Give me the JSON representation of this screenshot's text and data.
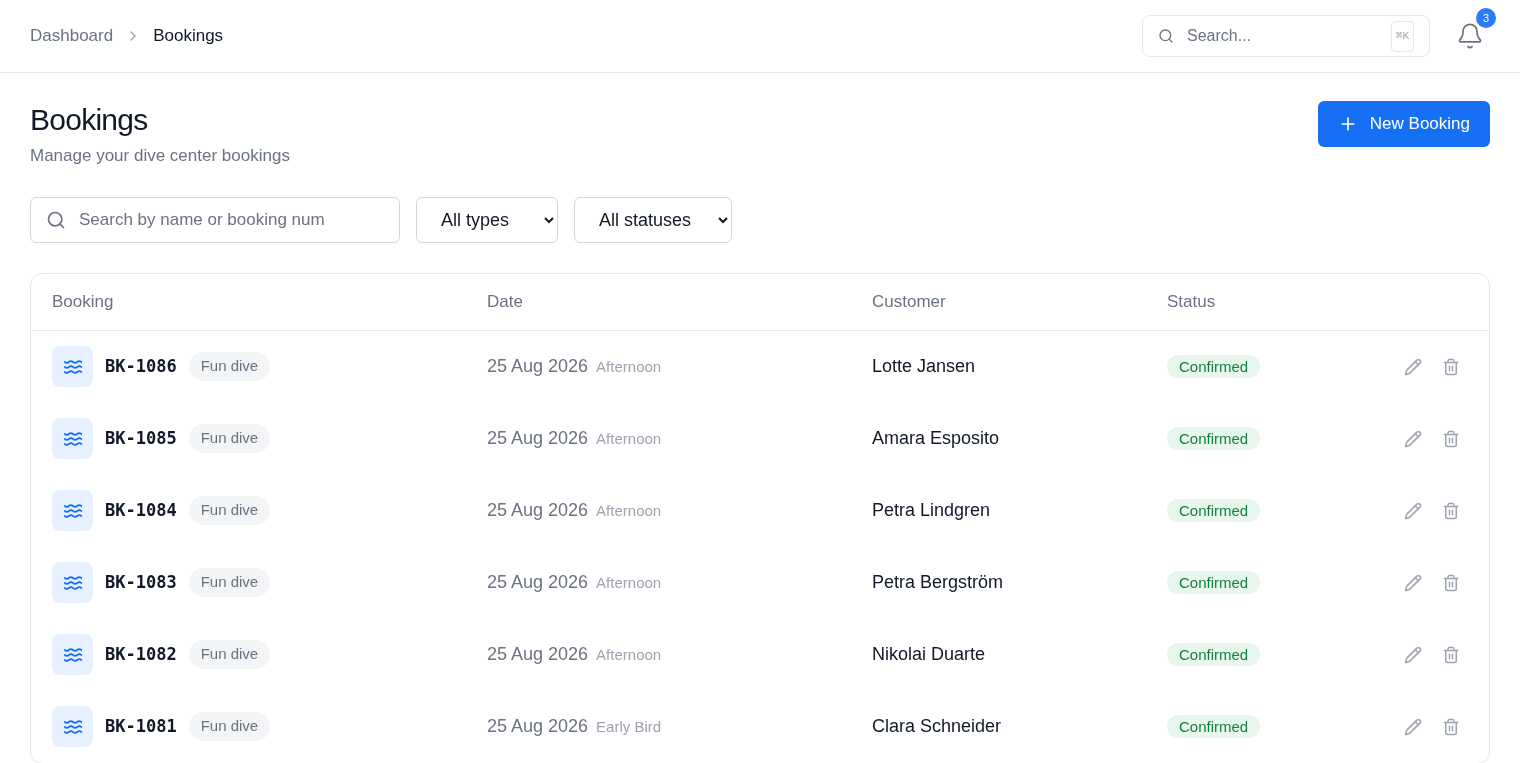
{
  "breadcrumb": [
    {
      "label": "Dashboard",
      "selected": false
    },
    {
      "label": "Bookings",
      "selected": true
    }
  ],
  "top_search": {
    "placeholder": "Search...",
    "shortcut": "⌘K"
  },
  "notifications": {
    "count": "3"
  },
  "page": {
    "title": "Bookings",
    "subtitle": "Manage your dive center bookings",
    "new_button": "New Booking"
  },
  "filters": {
    "search_placeholder": "Search by name or booking num",
    "type_select": "All types",
    "status_select": "All statuses"
  },
  "table": {
    "columns": [
      "Booking",
      "Date",
      "Customer",
      "Status"
    ],
    "rows": [
      {
        "number": "BK-1086",
        "type": "Fun dive",
        "date": "25 Aug 2026",
        "slot": "Afternoon",
        "customer": "Lotte Jansen",
        "status": "Confirmed"
      },
      {
        "number": "BK-1085",
        "type": "Fun dive",
        "date": "25 Aug 2026",
        "slot": "Afternoon",
        "customer": "Amara Esposito",
        "status": "Confirmed"
      },
      {
        "number": "BK-1084",
        "type": "Fun dive",
        "date": "25 Aug 2026",
        "slot": "Afternoon",
        "customer": "Petra Lindgren",
        "status": "Confirmed"
      },
      {
        "number": "BK-1083",
        "type": "Fun dive",
        "date": "25 Aug 2026",
        "slot": "Afternoon",
        "customer": "Petra Bergström",
        "status": "Confirmed"
      },
      {
        "number": "BK-1082",
        "type": "Fun dive",
        "date": "25 Aug 2026",
        "slot": "Afternoon",
        "customer": "Nikolai Duarte",
        "status": "Confirmed"
      },
      {
        "number": "BK-1081",
        "type": "Fun dive",
        "date": "25 Aug 2026",
        "slot": "Early Bird",
        "customer": "Clara Schneider",
        "status": "Confirmed"
      }
    ]
  }
}
